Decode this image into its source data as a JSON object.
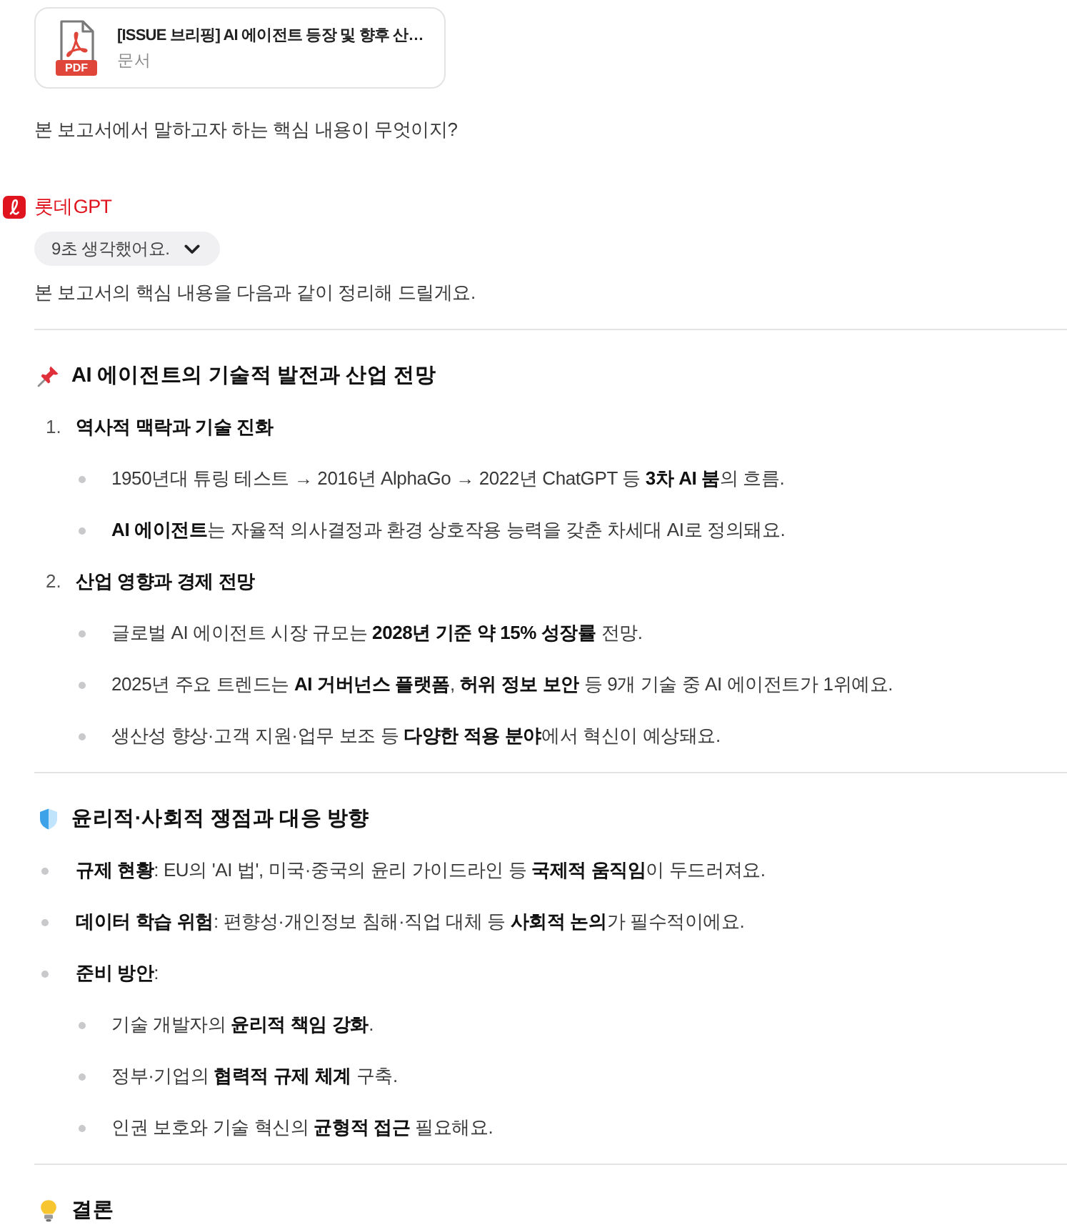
{
  "attachment": {
    "file_type": "PDF",
    "title": "[ISSUE 브리핑] AI 에이전트 등장 및 향후 산…",
    "type_label": "문서"
  },
  "user_message": "본 보고서에서 말하고자 하는 핵심 내용이 무엇이지?",
  "assistant": {
    "name": "롯데GPT",
    "thinking": {
      "label": "9초 생각했어요.",
      "expanded": false
    },
    "intro": "본 보고서의 핵심 내용을 다음과 같이 정리해 드릴게요."
  },
  "sections": [
    {
      "title": "AI 에이전트의 기술적 발전과 산업 전망",
      "items": [
        {
          "kind": "numbered",
          "marker": "1.",
          "text": "역사적 맥락과 기술 진화",
          "children": [
            {
              "kind": "bullet",
              "text": "1950년대 튜링 테스트 → 2016년 AlphaGo → 2022년 ChatGPT 등 **3차 AI 붐**의 흐름."
            },
            {
              "kind": "bullet",
              "text": "**AI 에이전트**는 자율적 의사결정과 환경 상호작용 능력을 갖춘 차세대 AI로 정의돼요."
            }
          ]
        },
        {
          "kind": "numbered",
          "marker": "2.",
          "text": "산업 영향과 경제 전망",
          "children": [
            {
              "kind": "bullet",
              "text": "글로벌 AI 에이전트 시장 규모는 **2028년 기준 약 15% 성장률** 전망."
            },
            {
              "kind": "bullet",
              "text": "2025년 주요 트렌드는 **AI 거버넌스 플랫폼**, **허위 정보 보안** 등 9개 기술 중 AI 에이전트가 1위예요."
            },
            {
              "kind": "bullet",
              "text": "생산성 향상·고객 지원·업무 보조 등 **다양한 적용 분야**에서 혁신이 예상돼요."
            }
          ]
        }
      ]
    },
    {
      "title": "윤리적·사회적 쟁점과 대응 방향",
      "items": [
        {
          "kind": "bullet",
          "text": "**규제 현황**: EU의 'AI 법', 미국·중국의 윤리 가이드라인 등 **국제적 움직임**이 두드러져요."
        },
        {
          "kind": "bullet",
          "text": "**데이터 학습 위험**: 편향성·개인정보 침해·직업 대체 등 **사회적 논의**가 필수적이에요."
        },
        {
          "kind": "bullet",
          "text": "**준비 방안**:",
          "children": [
            {
              "kind": "bullet",
              "text": "기술 개발자의 **윤리적 책임 강화**."
            },
            {
              "kind": "bullet",
              "text": "정부·기업의 **협력적 규제 체계** 구축."
            },
            {
              "kind": "bullet",
              "text": "인권 보호와 기술 혁신의 **균형적 접근** 필요해요."
            }
          ]
        }
      ]
    },
    {
      "title": "결론"
    }
  ]
}
